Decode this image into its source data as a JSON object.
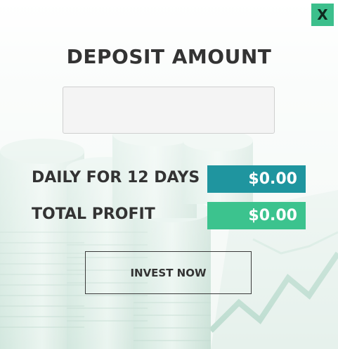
{
  "modal": {
    "close_label": "X",
    "title": "DEPOSIT AMOUNT",
    "amount_input": {
      "value": "",
      "placeholder": ""
    },
    "daily": {
      "label": "DAILY FOR 12 DAYS",
      "value": "$0.00"
    },
    "total": {
      "label": "TOTAL PROFIT",
      "value": "$0.00"
    },
    "invest_label": "INVEST NOW"
  },
  "colors": {
    "close_bg": "#3cbf8c",
    "daily_value_bg": "#1f959f",
    "total_value_bg": "#3cc38e",
    "text_dark": "#333333"
  },
  "icons": {
    "background": "coins-and-chart-background"
  }
}
